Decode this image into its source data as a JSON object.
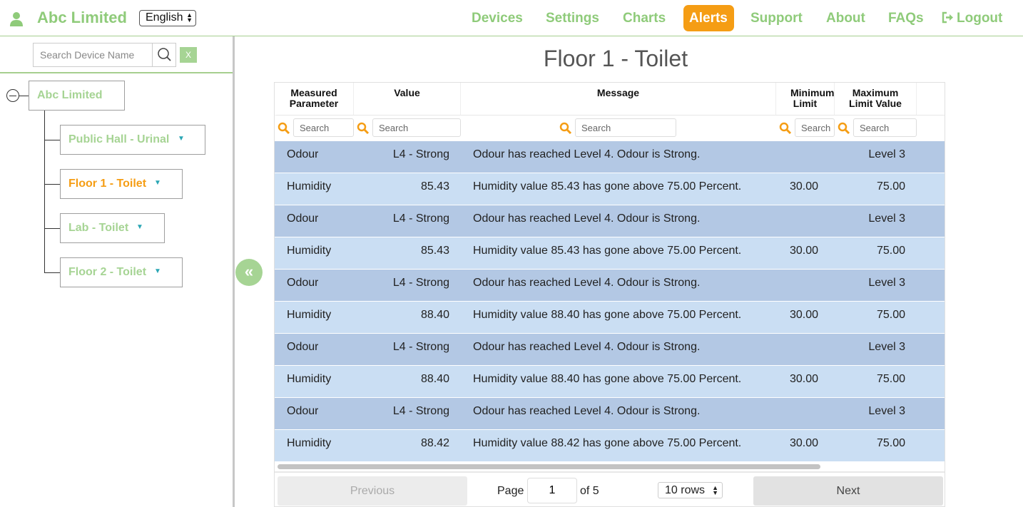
{
  "header": {
    "brand": "Abc Limited",
    "language": "English",
    "nav": [
      {
        "label": "Devices",
        "active": false
      },
      {
        "label": "Settings",
        "active": false
      },
      {
        "label": "Charts",
        "active": false
      },
      {
        "label": "Alerts",
        "active": true
      },
      {
        "label": "Support",
        "active": false
      },
      {
        "label": "About",
        "active": false
      },
      {
        "label": "FAQs",
        "active": false
      },
      {
        "label": "Logout",
        "active": false
      }
    ],
    "accent_color": "#8fcb7a",
    "active_color": "#f59d14"
  },
  "sidebar": {
    "search_placeholder": "Search Device Name",
    "clear_label": "X",
    "root": "Abc Limited",
    "nodes": [
      {
        "label": "Public Hall - Urinal",
        "active": false
      },
      {
        "label": "Floor 1 - Toilet",
        "active": true
      },
      {
        "label": "Lab - Toilet",
        "active": false
      },
      {
        "label": "Floor 2 - Toilet",
        "active": false
      }
    ],
    "toggle_label": "«"
  },
  "main": {
    "title": "Floor 1 - Toilet",
    "columns": [
      "Measured Parameter",
      "Value",
      "Message",
      "Minimum Limit",
      "Maximum Limit Value"
    ],
    "filter_placeholder": "Search",
    "rows": [
      {
        "param": "Odour",
        "value": "L4 - Strong",
        "message": "Odour has reached Level 4. Odour is Strong.",
        "min": "",
        "max": "Level 3"
      },
      {
        "param": "Humidity",
        "value": "85.43",
        "message": "Humidity value 85.43 has gone above 75.00 Percent.",
        "min": "30.00",
        "max": "75.00"
      },
      {
        "param": "Odour",
        "value": "L4 - Strong",
        "message": "Odour has reached Level 4. Odour is Strong.",
        "min": "",
        "max": "Level 3"
      },
      {
        "param": "Humidity",
        "value": "85.43",
        "message": "Humidity value 85.43 has gone above 75.00 Percent.",
        "min": "30.00",
        "max": "75.00"
      },
      {
        "param": "Odour",
        "value": "L4 - Strong",
        "message": "Odour has reached Level 4. Odour is Strong.",
        "min": "",
        "max": "Level 3"
      },
      {
        "param": "Humidity",
        "value": "88.40",
        "message": "Humidity value 88.40 has gone above 75.00 Percent.",
        "min": "30.00",
        "max": "75.00"
      },
      {
        "param": "Odour",
        "value": "L4 - Strong",
        "message": "Odour has reached Level 4. Odour is Strong.",
        "min": "",
        "max": "Level 3"
      },
      {
        "param": "Humidity",
        "value": "88.40",
        "message": "Humidity value 88.40 has gone above 75.00 Percent.",
        "min": "30.00",
        "max": "75.00"
      },
      {
        "param": "Odour",
        "value": "L4 - Strong",
        "message": "Odour has reached Level 4. Odour is Strong.",
        "min": "",
        "max": "Level 3"
      },
      {
        "param": "Humidity",
        "value": "88.42",
        "message": "Humidity value 88.42 has gone above 75.00 Percent.",
        "min": "30.00",
        "max": "75.00"
      }
    ],
    "pagination": {
      "prev_label": "Previous",
      "page_label": "Page",
      "current_page": "1",
      "of_label": "of 5",
      "rows_label": "10 rows",
      "next_label": "Next"
    },
    "row_colors": {
      "odd": "#b3c8e4",
      "even": "#cadef3"
    }
  }
}
